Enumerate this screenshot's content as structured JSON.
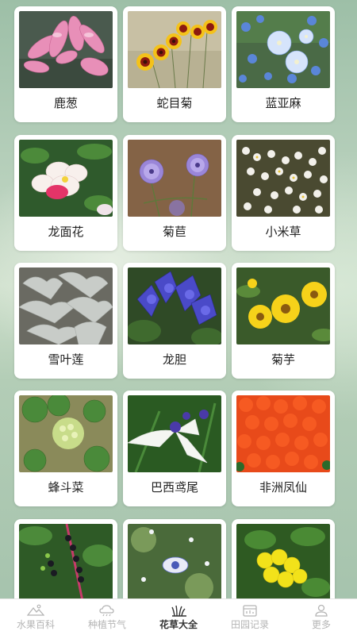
{
  "plants": [
    {
      "name": "鹿葱"
    },
    {
      "name": "蛇目菊"
    },
    {
      "name": "蓝亚麻"
    },
    {
      "name": "龙面花"
    },
    {
      "name": "菊苣"
    },
    {
      "name": "小米草"
    },
    {
      "name": "雪叶莲"
    },
    {
      "name": "龙胆"
    },
    {
      "name": "菊芋"
    },
    {
      "name": "蜂斗菜"
    },
    {
      "name": "巴西鸢尾"
    },
    {
      "name": "非洲凤仙"
    },
    {
      "name": ""
    },
    {
      "name": ""
    },
    {
      "name": ""
    }
  ],
  "tabbar": {
    "active_index": 2,
    "tabs": [
      {
        "label": "水果百科",
        "icon": "fruit-mountain-icon"
      },
      {
        "label": "种植节气",
        "icon": "weather-cloud-icon"
      },
      {
        "label": "花草大全",
        "icon": "grass-plant-icon"
      },
      {
        "label": "田园记录",
        "icon": "calendar-record-icon"
      },
      {
        "label": "更多",
        "icon": "user-profile-icon"
      }
    ]
  },
  "colors": {
    "active_tab": "#333333",
    "inactive_tab": "#b5b5b5",
    "card_bg": "#ffffff"
  }
}
